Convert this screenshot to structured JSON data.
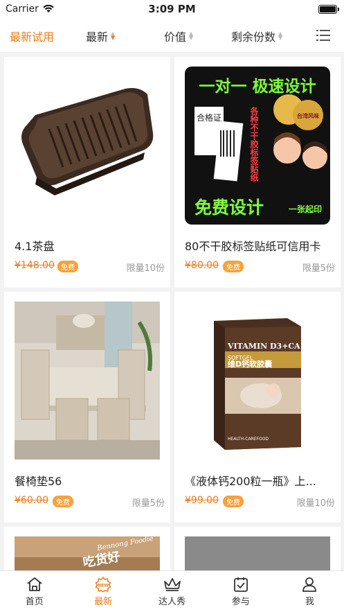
{
  "status": {
    "carrier": "Carrier",
    "time": "3:09 PM"
  },
  "filters": [
    {
      "label": "最新试用"
    },
    {
      "label": "最新"
    },
    {
      "label": "价值"
    },
    {
      "label": "剩余份数"
    }
  ],
  "products": [
    {
      "title": "4.1茶盘",
      "price": "¥148.00",
      "badge": "免费",
      "limit": "限量10份"
    },
    {
      "title": "80不干胶标签贴纸可信用卡",
      "price": "¥80.00",
      "badge": "免费",
      "limit": "限量5份",
      "image_text": {
        "top": "一对一 极速设计",
        "bottom": "免费设计",
        "bottom_small": "一张起印",
        "vertical": "各种不干胶标签贴纸",
        "label1": "合格证",
        "seal": "台湾风味"
      }
    },
    {
      "title": "餐椅垫56",
      "price": "¥60.00",
      "badge": "免费",
      "limit": "限量5份"
    },
    {
      "title": "《液体钙200粒一瓶》上...",
      "price": "¥99.00",
      "badge": "免费",
      "limit": "限量10份",
      "image_text": {
        "brand": "VITAMIN D3+CA",
        "sub": "SOFTGEL",
        "cn": "维D钙软胶囊",
        "footer": "HEALTH-CAREFOOD"
      }
    },
    {
      "title": "",
      "price": "",
      "badge": "",
      "limit": "",
      "image_text": {
        "line1": "Bennong Foodie",
        "line2": "吃货好"
      }
    },
    {
      "title": "",
      "price": "",
      "badge": "",
      "limit": ""
    }
  ],
  "tabs": [
    {
      "label": "首页",
      "icon": "home-icon"
    },
    {
      "label": "最新",
      "icon": "new-icon",
      "badge": "NEW"
    },
    {
      "label": "达人秀",
      "icon": "crown-icon"
    },
    {
      "label": "参与",
      "icon": "calendar-check-icon"
    },
    {
      "label": "我",
      "icon": "user-icon"
    }
  ],
  "colors": {
    "accent": "#f37a18",
    "badge": "#f7a23a",
    "background": "#f2f2f2"
  }
}
